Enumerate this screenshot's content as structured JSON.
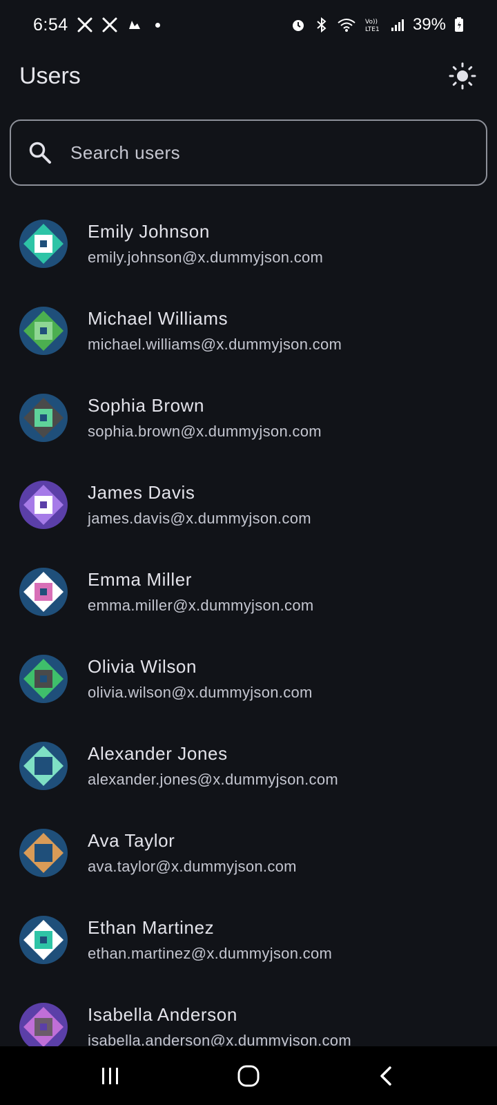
{
  "status_bar": {
    "time": "6:54",
    "battery": "39%",
    "left_icons": [
      "x-icon",
      "x-icon",
      "weather-icon",
      "dot"
    ],
    "right_icons": [
      "alarm-icon",
      "bluetooth-icon",
      "wifi-icon",
      "volte-icon",
      "signal-icon",
      "battery-icon"
    ]
  },
  "app_bar": {
    "title": "Users",
    "theme_toggle_icon": "sun-icon"
  },
  "search": {
    "placeholder": "Search users",
    "value": ""
  },
  "users": [
    {
      "name": "Emily Johnson",
      "email": "emily.johnson@x.dummyjson.com",
      "colors": [
        "#1f4f7a",
        "#2ec4a6",
        "#ffffff"
      ]
    },
    {
      "name": "Michael Williams",
      "email": "michael.williams@x.dummyjson.com",
      "colors": [
        "#1f4f7a",
        "#4caf50",
        "#8fd694"
      ]
    },
    {
      "name": "Sophia Brown",
      "email": "sophia.brown@x.dummyjson.com",
      "colors": [
        "#1f4f7a",
        "#4a4a4a",
        "#5fd39a"
      ]
    },
    {
      "name": "James Davis",
      "email": "james.davis@x.dummyjson.com",
      "colors": [
        "#5b3fa8",
        "#a67be8",
        "#ffffff"
      ]
    },
    {
      "name": "Emma Miller",
      "email": "emma.miller@x.dummyjson.com",
      "colors": [
        "#1f4f7a",
        "#ffffff",
        "#d86fb7"
      ]
    },
    {
      "name": "Olivia Wilson",
      "email": "olivia.wilson@x.dummyjson.com",
      "colors": [
        "#1f4f7a",
        "#3fbf6b",
        "#4a4a4a"
      ]
    },
    {
      "name": "Alexander Jones",
      "email": "alexander.jones@x.dummyjson.com",
      "colors": [
        "#1f4f7a",
        "#7fe0c4",
        "#1f4f7a"
      ]
    },
    {
      "name": "Ava Taylor",
      "email": "ava.taylor@x.dummyjson.com",
      "colors": [
        "#1f4f7a",
        "#d99b57",
        "#1f4f7a"
      ]
    },
    {
      "name": "Ethan Martinez",
      "email": "ethan.martinez@x.dummyjson.com",
      "colors": [
        "#1f4f7a",
        "#ffffff",
        "#2ec4a6"
      ]
    },
    {
      "name": "Isabella Anderson",
      "email": "isabella.anderson@x.dummyjson.com",
      "colors": [
        "#5b3fa8",
        "#c06fd8",
        "#6b5b6b"
      ]
    }
  ],
  "nav_bar": {
    "buttons": [
      "recents-icon",
      "home-icon",
      "back-icon"
    ]
  }
}
